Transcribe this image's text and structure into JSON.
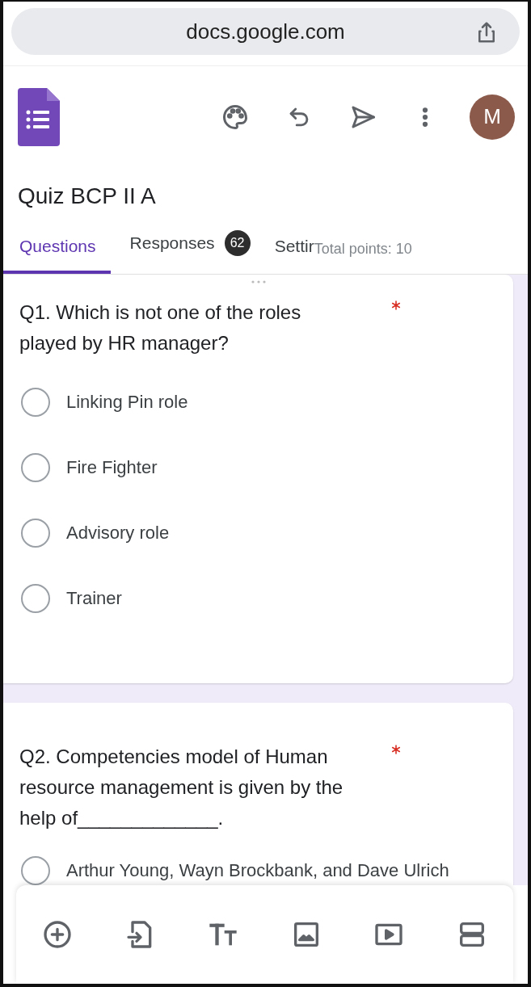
{
  "browser": {
    "url": "docs.google.com"
  },
  "header": {
    "avatar_letter": "M"
  },
  "form": {
    "title": "Quiz BCP II A"
  },
  "tabs": [
    {
      "label": "Questions",
      "selected": true
    },
    {
      "label": "Responses",
      "selected": false,
      "badge": "62"
    },
    {
      "label": "Settir",
      "selected": false
    }
  ],
  "total_points": "Total points: 10",
  "questions": [
    {
      "text": "Q1. Which is not one of the roles played by HR manager?",
      "required": true,
      "options": [
        {
          "label": "Linking Pin role",
          "selected": false
        },
        {
          "label": "Fire Fighter",
          "selected": false
        },
        {
          "label": "Advisory role",
          "selected": false
        },
        {
          "label": "Trainer",
          "selected": false
        }
      ]
    },
    {
      "text": "Q2. Competencies model of Human resource management is given by the help of_____________.",
      "required": true,
      "options": [
        {
          "label": "Arthur Young, Wayn Brockbank, and Dave Ulrich",
          "selected": false
        }
      ]
    }
  ]
}
